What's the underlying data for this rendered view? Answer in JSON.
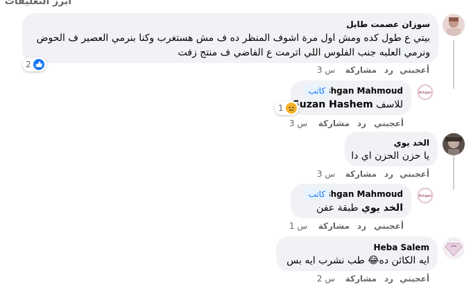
{
  "section_title": "أبرز التعليقات",
  "comments": [
    {
      "author": "سوزان عصمت طايل",
      "text": "بيتي ع طول كده ومش اول مرة اشوف المنظر ده ف مش هستغرب وكنا بنرمي العصير ف الحوض ونرمي العلبه جنب الفلوس اللي اترمت ع الفاضي ف منتج زفت",
      "actions": {
        "like": "أعجبني",
        "reply": "رد",
        "share": "مشاركة",
        "time": "3 س"
      },
      "reactions": {
        "count": "2",
        "icon": "like-icon"
      }
    },
    {
      "author": "Ashgan Mahmoud",
      "badge": "كاتب",
      "mention": "Suzan Hashem",
      "text": "للاسف",
      "actions": {
        "like": "أعجبني",
        "reply": "رد",
        "share": "مشاركة",
        "time": "3 س"
      },
      "reactions": {
        "count": "1",
        "icon": "sad-icon"
      }
    },
    {
      "author": "الخد يوي",
      "text": "يا حزن الحزن اي دا",
      "actions": {
        "like": "أعجبني",
        "reply": "رد",
        "share": "مشاركة",
        "time": "3 س"
      }
    },
    {
      "author": "Ashgan Mahmoud",
      "badge": "كاتب",
      "mention": "الخد يوي",
      "text": "طبقة عفن",
      "actions": {
        "like": "أعجبني",
        "reply": "رد",
        "share": "مشاركة",
        "time": "1 س"
      }
    },
    {
      "author": "Heba Salem",
      "text": "ايه الكائن ده😂 طب نشرب ايه بس",
      "actions": {
        "like": "أعجبني",
        "reply": "رد",
        "share": "مشاركة",
        "time": "2 س"
      }
    }
  ],
  "avatar_labels": {
    "ashgan": "Ashgan"
  },
  "colors": {
    "bubble": "#f0f2f5",
    "badge_bg": "#e7f3ff",
    "badge_text": "#1877f2",
    "meta": "#65676b"
  }
}
